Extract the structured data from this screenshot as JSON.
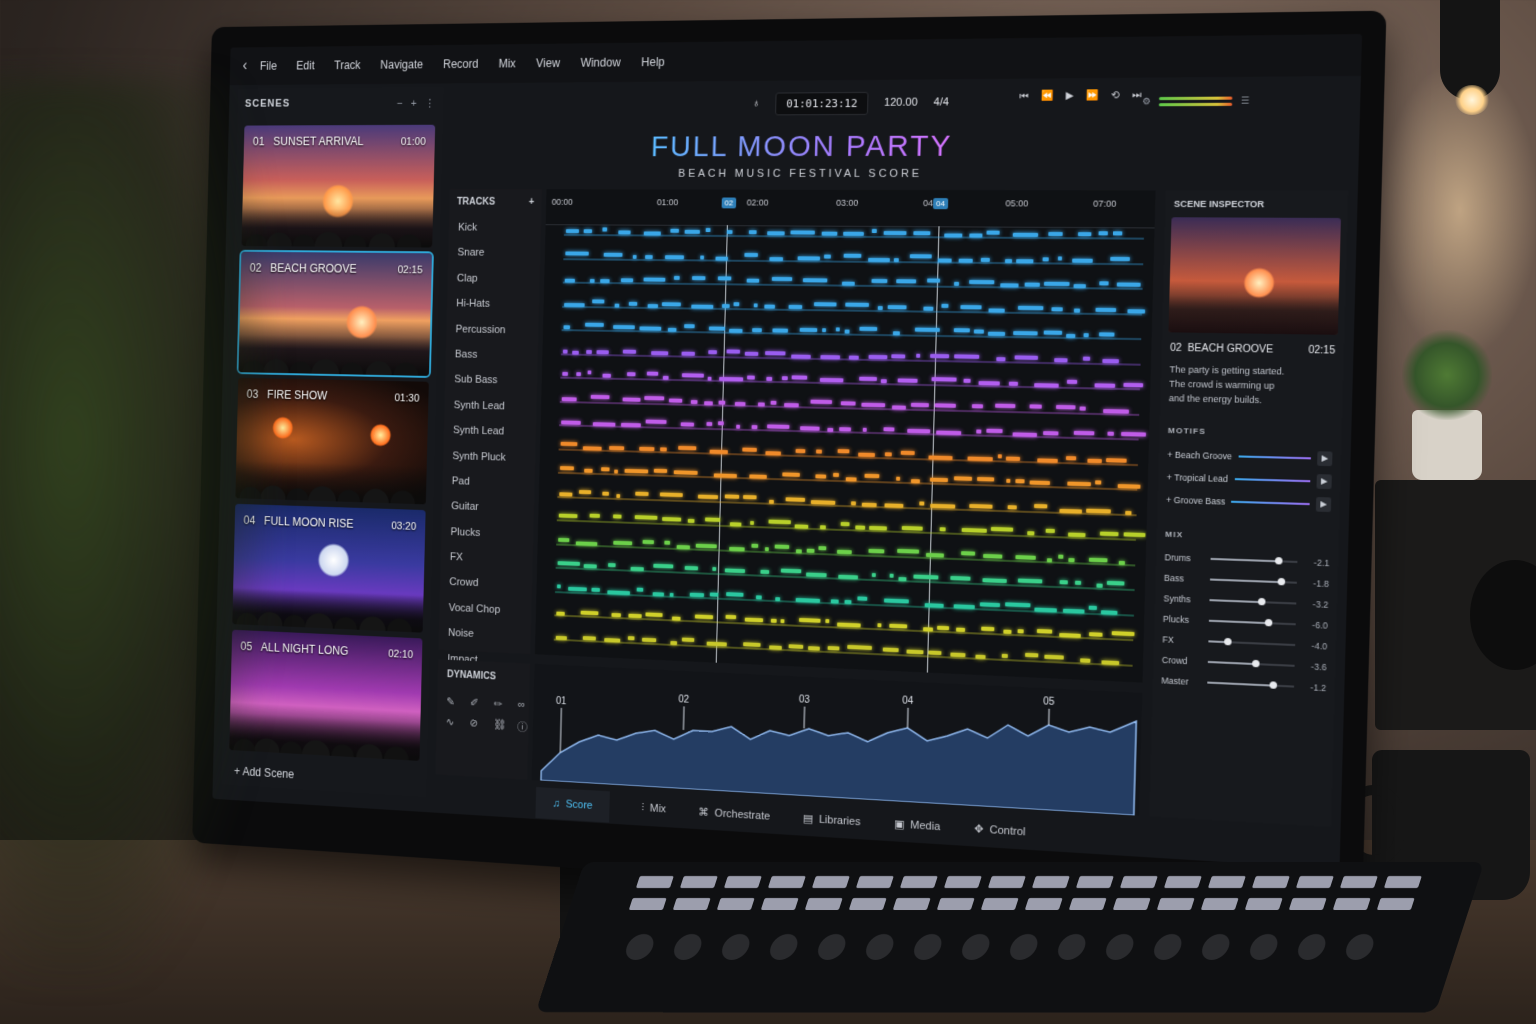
{
  "menu": [
    "File",
    "Edit",
    "Track",
    "Navigate",
    "Record",
    "Mix",
    "View",
    "Window",
    "Help"
  ],
  "transport": {
    "timecode": "01:01:23:12",
    "tempo": "120.00",
    "signature": "4/4"
  },
  "scenes": {
    "title": "SCENES",
    "items": [
      {
        "num": "01",
        "name": "SUNSET ARRIVAL",
        "duration": "01:00"
      },
      {
        "num": "02",
        "name": "BEACH GROOVE",
        "duration": "02:15"
      },
      {
        "num": "03",
        "name": "FIRE SHOW",
        "duration": "01:30"
      },
      {
        "num": "04",
        "name": "FULL MOON RISE",
        "duration": "03:20"
      },
      {
        "num": "05",
        "name": "ALL NIGHT LONG",
        "duration": "02:10"
      }
    ],
    "add_label": "Add Scene"
  },
  "header": {
    "title": "FULL MOON PARTY",
    "subtitle": "BEACH MUSIC FESTIVAL SCORE"
  },
  "tracks": {
    "title": "TRACKS",
    "items": [
      "Kick",
      "Snare",
      "Clap",
      "Hi-Hats",
      "Percussion",
      "Bass",
      "Sub Bass",
      "Synth Lead",
      "Synth Lead",
      "Synth Pluck",
      "Pad",
      "Guitar",
      "Plucks",
      "FX",
      "Crowd",
      "Vocal Chop",
      "Noise",
      "Impact"
    ]
  },
  "ruler": {
    "ticks": [
      "00:00",
      "01:00",
      "02:00",
      "03:00",
      "04:00",
      "05:00",
      "07:00"
    ],
    "markers": [
      "02",
      "04"
    ]
  },
  "dynamics": {
    "title": "DYNAMICS",
    "markers": [
      "01",
      "02",
      "03",
      "04",
      "05"
    ]
  },
  "tabs": [
    "Score",
    "Mix",
    "Orchestrate",
    "Libraries",
    "Media",
    "Control"
  ],
  "inspector": {
    "title": "SCENE INSPECTOR",
    "scene_num": "02",
    "scene_name": "BEACH GROOVE",
    "scene_duration": "02:15",
    "desc": [
      "The party is getting started.",
      "The crowd is warming up",
      "and the energy builds."
    ],
    "motifs_title": "MOTIFS",
    "motifs": [
      "Beach Groove",
      "Tropical Lead",
      "Groove Bass"
    ],
    "mix_title": "MIX",
    "mix": [
      {
        "label": "Drums",
        "value": "-2.1",
        "level": 0.78
      },
      {
        "label": "Bass",
        "value": "-1.8",
        "level": 0.82
      },
      {
        "label": "Synths",
        "value": "-3.2",
        "level": 0.6
      },
      {
        "label": "Plucks",
        "value": "-6.0",
        "level": 0.68
      },
      {
        "label": "FX",
        "value": "-4.0",
        "level": 0.22
      },
      {
        "label": "Crowd",
        "value": "-3.6",
        "level": 0.55
      },
      {
        "label": "Master",
        "value": "-1.2",
        "level": 0.75
      }
    ]
  },
  "colors": {
    "accent": "#2fa8d8",
    "lanes": [
      "#3aa7e8",
      "#3aa7e8",
      "#3aa7e8",
      "#3aa7e8",
      "#3aa7e8",
      "#9a5df0",
      "#b25ef0",
      "#c05ce8",
      "#c05ce8",
      "#f08a2a",
      "#f0962a",
      "#e8b02a",
      "#b8d02a",
      "#6cd04a",
      "#3ad08a",
      "#2ac8a0",
      "#d0d02a",
      "#c8c82a"
    ]
  }
}
